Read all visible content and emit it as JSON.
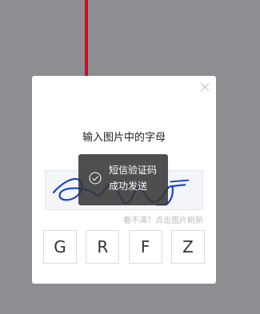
{
  "dialog": {
    "title": "输入图片中的字母",
    "refresh_hint": "看不清？点击图片刷新",
    "options": [
      "G",
      "R",
      "F",
      "Z"
    ]
  },
  "toast": {
    "line1": "短信验证码",
    "line2": "成功发送"
  },
  "colors": {
    "overlay": "#8d8e92",
    "arrow": "#e60012",
    "captcha_ink": "#1a3fd1"
  },
  "icons": {
    "close": "close-icon",
    "success": "check-circle-icon"
  }
}
